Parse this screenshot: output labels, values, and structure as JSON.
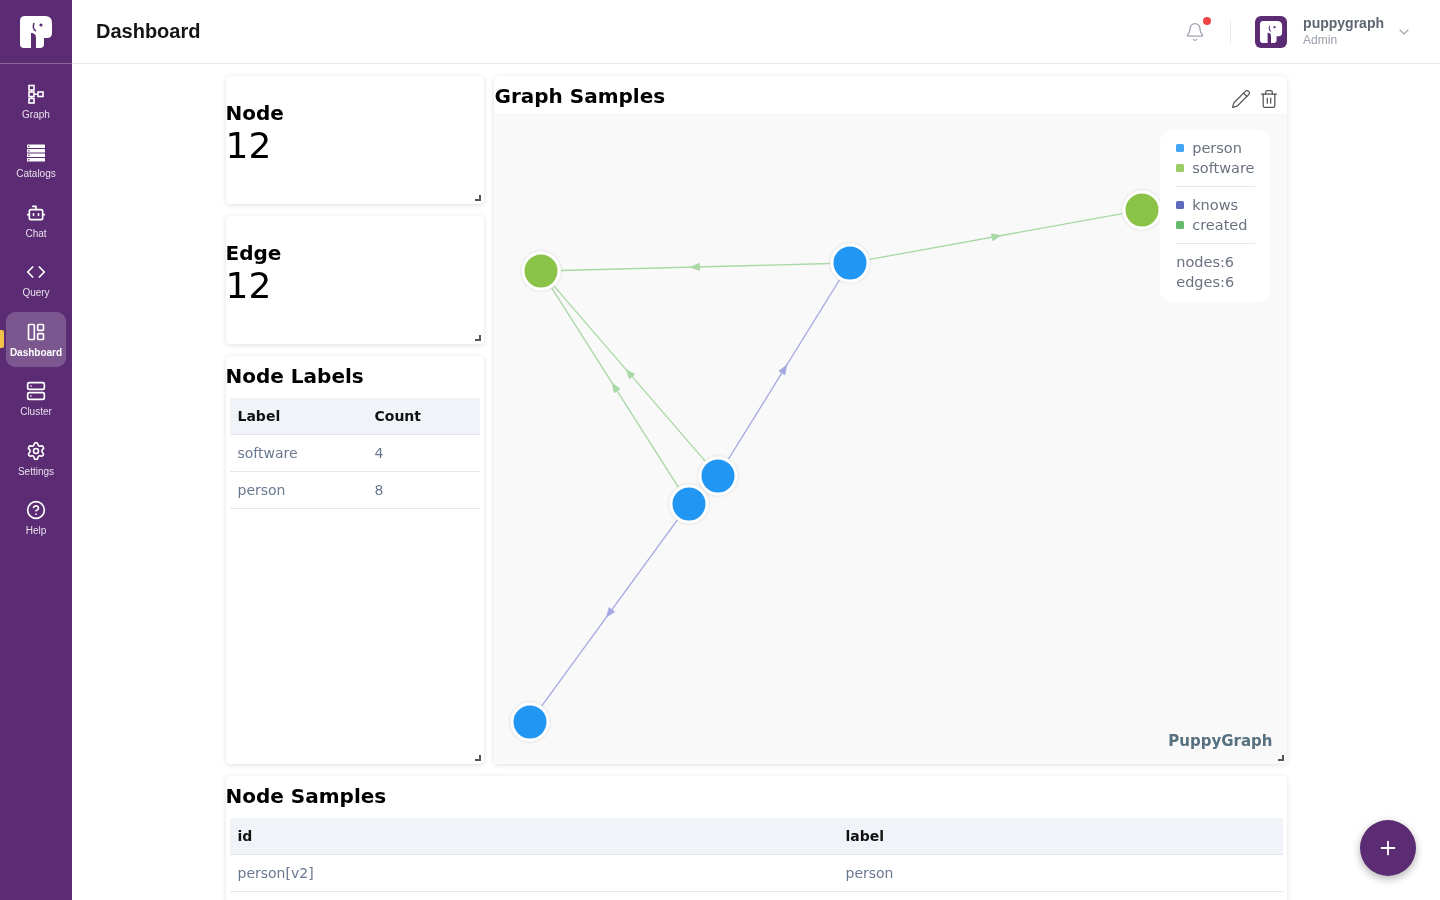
{
  "sidebar": {
    "items": [
      {
        "label": "Graph",
        "selected": false
      },
      {
        "label": "Catalogs",
        "selected": false
      },
      {
        "label": "Chat",
        "selected": false
      },
      {
        "label": "Query",
        "selected": false
      },
      {
        "label": "Dashboard",
        "selected": true
      },
      {
        "label": "Cluster",
        "selected": false
      },
      {
        "label": "Settings",
        "selected": false
      },
      {
        "label": "Help",
        "selected": false
      }
    ]
  },
  "header": {
    "title": "Dashboard",
    "notification_unread": true,
    "user": {
      "name": "puppygraph",
      "role": "Admin"
    }
  },
  "stat_cards": [
    {
      "title": "Node",
      "value": "12"
    },
    {
      "title": "Edge",
      "value": "12"
    }
  ],
  "node_labels": {
    "title": "Node Labels",
    "columns": [
      "Label",
      "Count"
    ],
    "rows": [
      [
        "software",
        "4"
      ],
      [
        "person",
        "8"
      ]
    ]
  },
  "graph_samples": {
    "title": "Graph Samples",
    "legend": {
      "node_types": [
        {
          "label": "person",
          "color": "#42a5f5"
        },
        {
          "label": "software",
          "color": "#9ccc65"
        }
      ],
      "edge_types": [
        {
          "label": "knows",
          "color": "#5c6bc0"
        },
        {
          "label": "created",
          "color": "#66bb6a"
        }
      ],
      "stats": [
        "nodes:6",
        "edges:6"
      ]
    },
    "nodes": [
      {
        "color": "#8bc34a"
      },
      {
        "color": "#2196f3"
      },
      {
        "color": "#8bc34a"
      },
      {
        "color": "#2196f3"
      },
      {
        "color": "#2196f3"
      },
      {
        "color": "#2196f3"
      }
    ],
    "edges": [
      {
        "color": "#a8d8a4"
      },
      {
        "color": "#a8d8a4"
      },
      {
        "color": "#a8d8a4"
      },
      {
        "color": "#a8d8a4"
      },
      {
        "color": "#a3a8e2"
      },
      {
        "color": "#a3a8e2"
      }
    ],
    "watermark": "PuppyGraph"
  },
  "node_samples": {
    "title": "Node Samples",
    "columns": [
      "id",
      "label"
    ],
    "rows": [
      [
        "person[v2]",
        "person"
      ]
    ]
  }
}
